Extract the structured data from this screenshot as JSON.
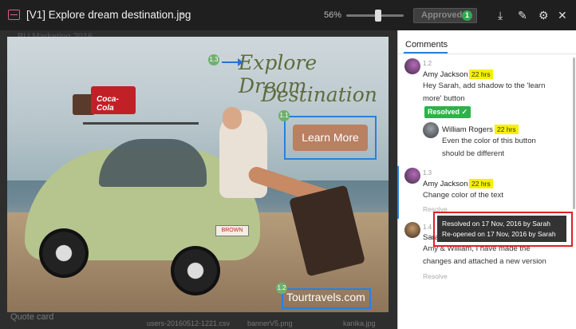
{
  "topbar": {
    "title": "[V1] Explore dream destination.jpg",
    "chevron": "⌄",
    "zoom": "56%",
    "zoom_fraction": 0.56,
    "approved_label": "Approved",
    "approved_count": "1",
    "icons": [
      "download-icon",
      "edit-icon",
      "settings-icon",
      "close-icon"
    ]
  },
  "background": {
    "header_text": "BU Marketing 2016",
    "quote_card": "Quote card",
    "file1": "users-20160512-1221.csv",
    "file2": "bannerV5.png",
    "file3": "kanika.jpg"
  },
  "image": {
    "headline_line1": "Explore Dream",
    "headline_line2": "Destination",
    "cta_label": "Learn More",
    "site": "Tourtravels.com",
    "cooler_brand": "Coca-Cola",
    "plate": "BROWN",
    "pins": [
      "1.3",
      "1.1",
      "1.2"
    ]
  },
  "comments_panel": {
    "tab": "Comments",
    "comments": [
      {
        "num": "1.2",
        "author": "Amy Jackson",
        "time": "22 hrs",
        "text_line1": "Hey Sarah, add shadow to the 'learn",
        "text_line2": "more' button",
        "status": "Resolved ✓",
        "reply": {
          "author": "William Rogers",
          "time": "22 hrs",
          "text_line1": "Even the color of this button",
          "text_line2": "should be different"
        }
      },
      {
        "num": "1.3",
        "author": "Amy Jackson",
        "time": "22 hrs",
        "text_line1": "Change color of the text",
        "action": "Resolve"
      },
      {
        "num": "1.4",
        "author": "Sarah",
        "text_line1": "Amy & William, I have made the",
        "text_line2": "changes and attached a new version",
        "action": "Resolve"
      }
    ],
    "tooltip_line1": "Resolved on 17 Nov, 2016 by Sarah",
    "tooltip_line2": "Re-opened on 17 Nov, 2016 by Sarah"
  },
  "colors": {
    "accent": "#2a7fe0",
    "resolved": "#2fb14a",
    "highlight": "#f7f000",
    "alert": "#e21f26"
  }
}
